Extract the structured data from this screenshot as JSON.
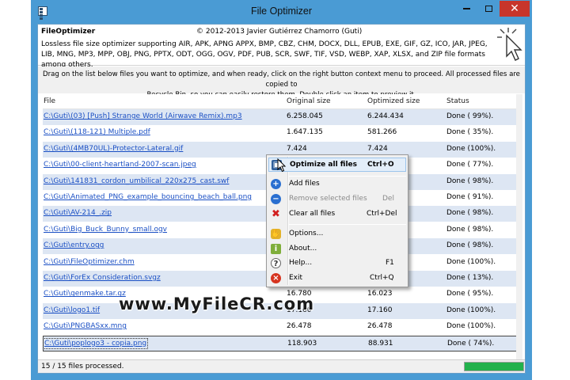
{
  "window": {
    "title": "File Optimizer",
    "minimize_icon": "minimize-icon",
    "maximize_icon": "maximize-icon",
    "close_label": "✕"
  },
  "header": {
    "app_name": "FileOptimizer",
    "copyright": "© 2012-2013 Javier Gutiérrez Chamorro (Guti)",
    "description": "Lossless file size optimizer supporting AIR, APK, APNG APPX, BMP, CBZ, CHM, DOCX, DLL, EPUB, EXE, GIF, GZ, ICO, JAR, JPEG, LIB, MNG, MP3, MPP, OBJ, PNG, PPTX, ODT, OGG, OGV, PDF, PUB, SCR, SWF, TIF, VSD, WEBP, XAP, XLSX, and ZIP file formats among others."
  },
  "instructions": {
    "line1": "Drag on the list below files you want to optimize, and when ready, click on the right button context menu to proceed. All processed files are copied to",
    "line2": "Recycle Bin, so you can easily restore them. Double click an item to preview it."
  },
  "table": {
    "columns": [
      "File",
      "Original size",
      "Optimized size",
      "Status"
    ],
    "rows": [
      {
        "file": "C:\\Guti\\(03) [Push] Strange World (Airwave Remix).mp3",
        "orig": "6.258.045",
        "opt": "6.244.434",
        "status": "Done ( 99%)."
      },
      {
        "file": "C:\\Guti\\(118-121) Multiple.pdf",
        "orig": "1.647.135",
        "opt": "581.266",
        "status": "Done ( 35%)."
      },
      {
        "file": "C:\\Guti\\(4MB70UL)-Protector-Lateral.gif",
        "orig": "7.424",
        "opt": "7.424",
        "status": "Done (100%)."
      },
      {
        "file": "C:\\Guti\\00-client-heartland-2007-scan.jpeg",
        "orig": "",
        "opt": "",
        "status": "Done ( 77%)."
      },
      {
        "file": "C:\\Guti\\141831_cordon_umbilical_220x275_cast.swf",
        "orig": "",
        "opt": "",
        "status": "Done ( 98%)."
      },
      {
        "file": "C:\\Guti\\Animated_PNG_example_bouncing_beach_ball.png",
        "orig": "",
        "opt": "",
        "status": "Done ( 91%)."
      },
      {
        "file": "C:\\Guti\\AV-214_.zip",
        "orig": "",
        "opt": "",
        "status": "Done ( 98%)."
      },
      {
        "file": "C:\\Guti\\Big_Buck_Bunny_small.ogv",
        "orig": "",
        "opt": "",
        "status": "Done ( 98%)."
      },
      {
        "file": "C:\\Guti\\entry.ogg",
        "orig": "",
        "opt": "",
        "status": "Done ( 98%)."
      },
      {
        "file": "C:\\Guti\\FileOptimizer.chm",
        "orig": "",
        "opt": "",
        "status": "Done (100%)."
      },
      {
        "file": "C:\\Guti\\ForEx Consideration.svgz",
        "orig": "",
        "opt": "",
        "status": "Done ( 13%)."
      },
      {
        "file": "C:\\Guti\\genmake.tar.gz",
        "orig": "16.780",
        "opt": "16.023",
        "status": "Done ( 95%)."
      },
      {
        "file": "C:\\Guti\\logo1.tif",
        "orig": "17.160",
        "opt": "17.160",
        "status": "Done (100%)."
      },
      {
        "file": "C:\\Guti\\PNGBASxx.mng",
        "orig": "26.478",
        "opt": "26.478",
        "status": "Done (100%)."
      },
      {
        "file": "C:\\Guti\\poplogo3 - copia.png",
        "orig": "118.903",
        "opt": "88.931",
        "status": "Done ( 74%)."
      }
    ]
  },
  "statusbar": {
    "text": "15 / 15 files processed.",
    "progress": 1.0,
    "progress_color": "#22b14c"
  },
  "context_menu": {
    "items": [
      {
        "label": "Optimize all files",
        "shortcut": "Ctrl+O",
        "icon": "optimize-icon"
      },
      {
        "label": "Add files",
        "shortcut": "",
        "icon": "add-icon"
      },
      {
        "label": "Remove selected files",
        "shortcut": "Del",
        "icon": "remove-icon"
      },
      {
        "label": "Clear all files",
        "shortcut": "Ctrl+Del",
        "icon": "clear-icon"
      },
      {
        "label": "Options...",
        "shortcut": "",
        "icon": "options-icon"
      },
      {
        "label": "About...",
        "shortcut": "",
        "icon": "about-icon"
      },
      {
        "label": "Help...",
        "shortcut": "F1",
        "icon": "help-icon"
      },
      {
        "label": "Exit",
        "shortcut": "Ctrl+Q",
        "icon": "exit-icon"
      }
    ]
  },
  "watermark": {
    "text": "www.MyFileCR.com"
  }
}
